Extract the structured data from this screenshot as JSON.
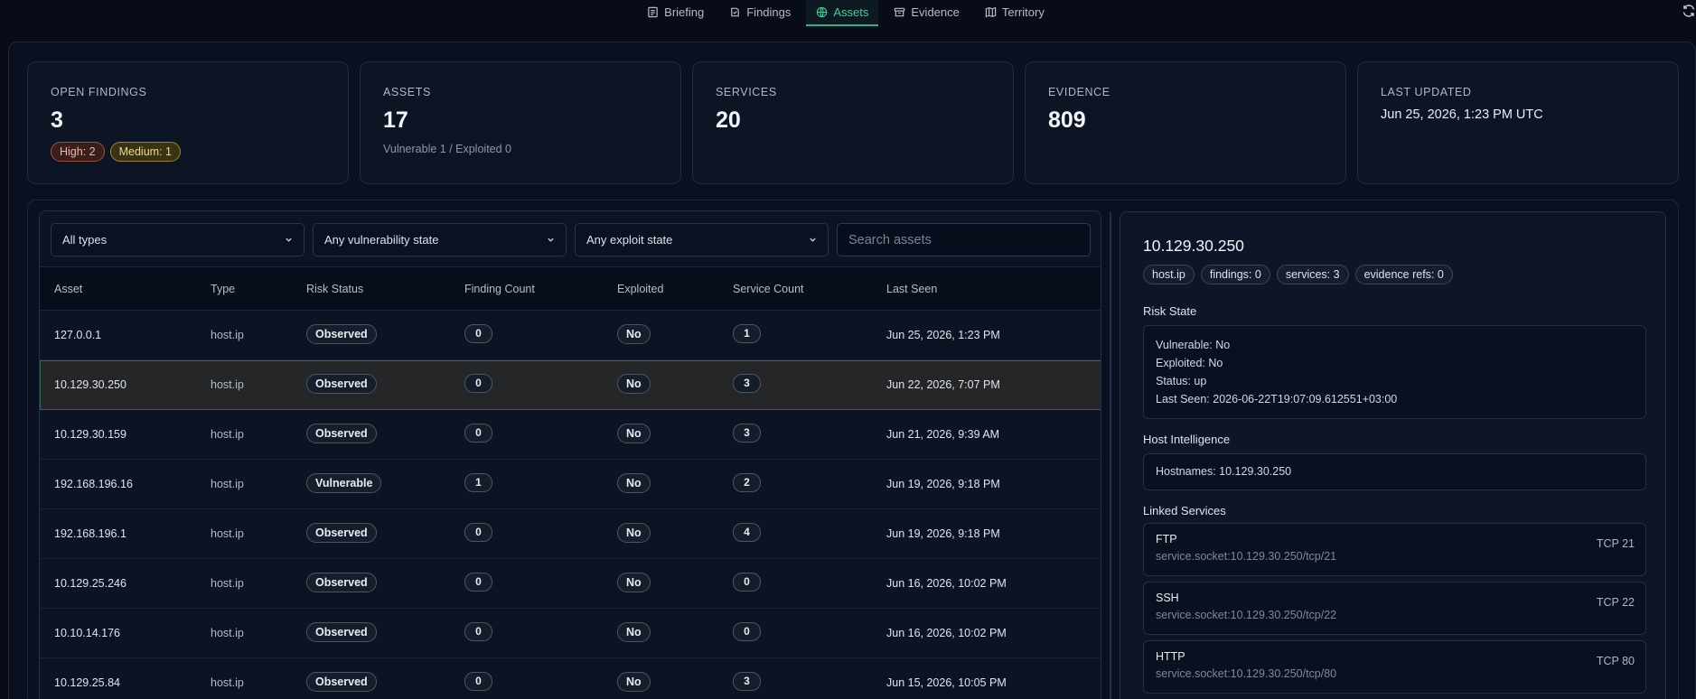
{
  "nav": {
    "tabs": [
      {
        "label": "Briefing",
        "icon": "briefing-icon"
      },
      {
        "label": "Findings",
        "icon": "findings-icon"
      },
      {
        "label": "Assets",
        "icon": "globe-icon",
        "active": true
      },
      {
        "label": "Evidence",
        "icon": "archive-icon"
      },
      {
        "label": "Territory",
        "icon": "map-icon"
      }
    ]
  },
  "stats": {
    "open_findings": {
      "label": "Open Findings",
      "value": "3",
      "high": "High: 2",
      "medium": "Medium: 1"
    },
    "assets": {
      "label": "Assets",
      "value": "17",
      "sub": "Vulnerable 1 / Exploited 0"
    },
    "services": {
      "label": "Services",
      "value": "20"
    },
    "evidence": {
      "label": "Evidence",
      "value": "809"
    },
    "last_updated": {
      "label": "Last Updated",
      "value": "Jun 25, 2026, 1:23 PM UTC"
    }
  },
  "filters": {
    "type": "All types",
    "vulnerability": "Any vulnerability state",
    "exploit": "Any exploit state",
    "search_placeholder": "Search assets"
  },
  "table": {
    "columns": [
      "Asset",
      "Type",
      "Risk Status",
      "Finding Count",
      "Exploited",
      "Service Count",
      "Last Seen"
    ],
    "rows": [
      {
        "asset": "127.0.0.1",
        "type": "host.ip",
        "risk": "Observed",
        "findings": "0",
        "exploited": "No",
        "services": "1",
        "last_seen": "Jun 25, 2026, 1:23 PM"
      },
      {
        "asset": "10.129.30.250",
        "type": "host.ip",
        "risk": "Observed",
        "findings": "0",
        "exploited": "No",
        "services": "3",
        "last_seen": "Jun 22, 2026, 7:07 PM",
        "selected": true
      },
      {
        "asset": "10.129.30.159",
        "type": "host.ip",
        "risk": "Observed",
        "findings": "0",
        "exploited": "No",
        "services": "3",
        "last_seen": "Jun 21, 2026, 9:39 AM"
      },
      {
        "asset": "192.168.196.16",
        "type": "host.ip",
        "risk": "Vulnerable",
        "findings": "1",
        "exploited": "No",
        "services": "2",
        "last_seen": "Jun 19, 2026, 9:18 PM"
      },
      {
        "asset": "192.168.196.1",
        "type": "host.ip",
        "risk": "Observed",
        "findings": "0",
        "exploited": "No",
        "services": "4",
        "last_seen": "Jun 19, 2026, 9:18 PM"
      },
      {
        "asset": "10.129.25.246",
        "type": "host.ip",
        "risk": "Observed",
        "findings": "0",
        "exploited": "No",
        "services": "0",
        "last_seen": "Jun 16, 2026, 10:02 PM"
      },
      {
        "asset": "10.10.14.176",
        "type": "host.ip",
        "risk": "Observed",
        "findings": "0",
        "exploited": "No",
        "services": "0",
        "last_seen": "Jun 16, 2026, 10:02 PM"
      },
      {
        "asset": "10.129.25.84",
        "type": "host.ip",
        "risk": "Observed",
        "findings": "0",
        "exploited": "No",
        "services": "3",
        "last_seen": "Jun 15, 2026, 10:05 PM"
      }
    ]
  },
  "detail": {
    "title": "10.129.30.250",
    "chips": [
      "host.ip",
      "findings: 0",
      "services: 3",
      "evidence refs: 0"
    ],
    "risk_state_label": "Risk State",
    "risk_state": [
      "Vulnerable: No",
      "Exploited: No",
      "Status: up",
      "Last Seen: 2026-06-22T19:07:09.612551+03:00"
    ],
    "host_intel_label": "Host Intelligence",
    "hostnames": "Hostnames: 10.129.30.250",
    "linked_label": "Linked Services",
    "services": [
      {
        "name": "FTP",
        "socket": "service.socket:10.129.30.250/tcp/21",
        "port": "TCP 21"
      },
      {
        "name": "SSH",
        "socket": "service.socket:10.129.30.250/tcp/22",
        "port": "TCP 22"
      },
      {
        "name": "HTTP",
        "socket": "service.socket:10.129.30.250/tcp/80",
        "port": "TCP 80"
      }
    ]
  }
}
